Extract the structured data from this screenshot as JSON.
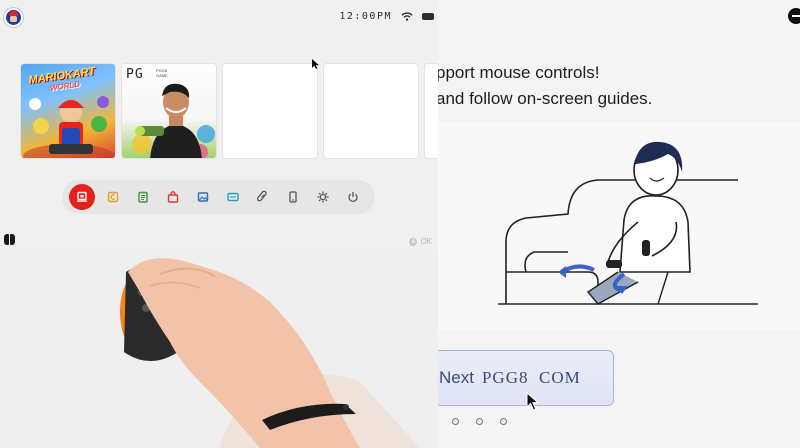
{
  "home": {
    "status": {
      "time": "12:00PM"
    },
    "tiles": [
      {
        "id": "mario-kart",
        "logo_line1": "MARIOKART",
        "logo_line2": "WORLD"
      },
      {
        "id": "pg-game",
        "logo": "PG",
        "sub": "PGG8 GAME"
      },
      {
        "id": "empty-1"
      },
      {
        "id": "empty-2"
      }
    ],
    "dock": [
      {
        "name": "shop-icon"
      },
      {
        "name": "news-icon"
      },
      {
        "name": "album-icon"
      },
      {
        "name": "eshop-bag-icon"
      },
      {
        "name": "gallery-icon"
      },
      {
        "name": "controllers-icon"
      },
      {
        "name": "link-icon"
      },
      {
        "name": "device-icon"
      },
      {
        "name": "settings-gear-icon"
      },
      {
        "name": "power-icon"
      }
    ],
    "ok_hint": "OK"
  },
  "tutorial": {
    "line1": "pport mouse controls!",
    "line2": "and follow on-screen guides.",
    "next_label": "Next",
    "next_url": "PGG8  COM"
  },
  "colors": {
    "accent_red": "#e4201a",
    "button_bg": "#e1e4f5",
    "button_border": "#a9b3d6",
    "arrow_blue": "#3b62c9"
  }
}
